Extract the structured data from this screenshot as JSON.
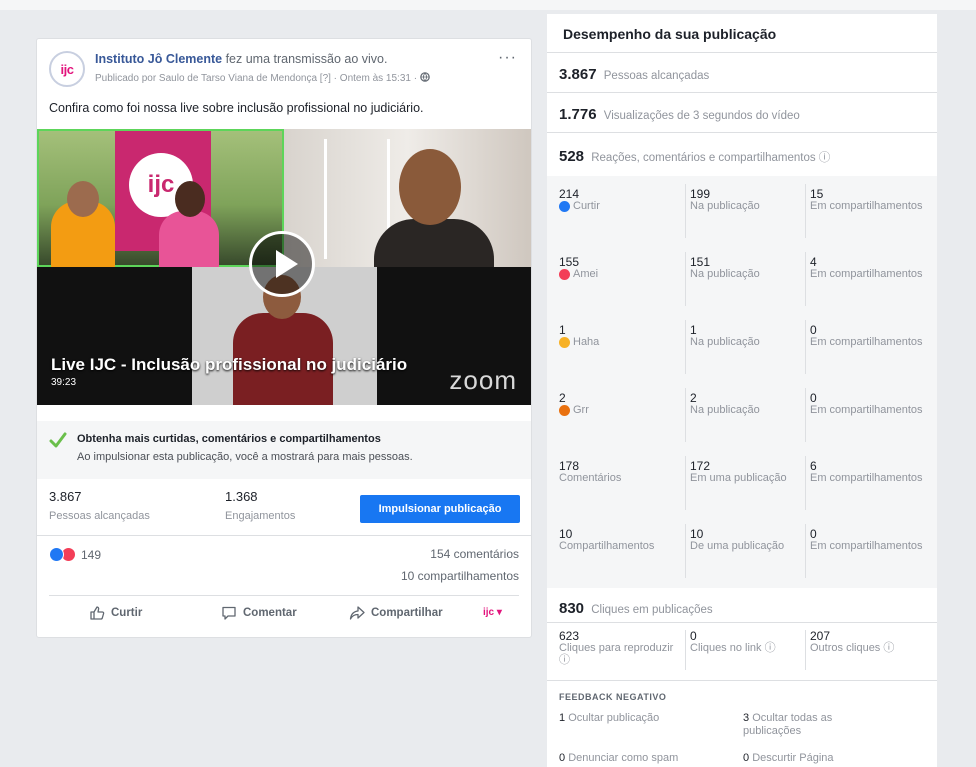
{
  "post": {
    "author": "Instituto Jô Clemente",
    "action_text": "fez uma transmissão ao vivo.",
    "published_by": "Publicado por Saulo de Tarso Viana de Mendonça [?] · Ontem às 15:31 ·",
    "avatar_text": "ijc",
    "more_label": "···",
    "caption": "Confira como foi nossa live sobre inclusão profissional no judiciário.",
    "video": {
      "title": "Live IJC - Inclusão profissional no judiciário",
      "duration": "39:23",
      "watermark": "zoom",
      "banner_text": "ijc"
    },
    "boost_tip": {
      "title": "Obtenha mais curtidas, comentários e compartilhamentos",
      "description": "Ao impulsionar esta publicação, você a mostrará para mais pessoas."
    },
    "stats": {
      "reached_num": "3.867",
      "reached_label": "Pessoas alcançadas",
      "engagement_num": "1.368",
      "engagement_label": "Engajamentos",
      "boost_button": "Impulsionar publicação"
    },
    "reactions_count": "149",
    "comments": "154 comentários",
    "shares": "10 compartilhamentos",
    "actions": {
      "like": "Curtir",
      "comment": "Comentar",
      "share": "Compartilhar"
    },
    "page_switch": "ijc ▾"
  },
  "panel": {
    "title": "Desempenho da sua publicação",
    "reached_num": "3.867",
    "reached_label": "Pessoas alcançadas",
    "views_num": "1.776",
    "views_label": "Visualizações de 3 segundos do vídeo",
    "reactions_num": "528",
    "reactions_label": "Reações, comentários e compartilhamentos ⓘ",
    "rows": [
      {
        "total": "214",
        "label": "Curtir",
        "icon": "like",
        "color": "#2078f4",
        "on_post": "199",
        "on_post_label": "Na publicação",
        "on_shares": "15",
        "on_shares_label": "Em compartilhamentos"
      },
      {
        "total": "155",
        "label": "Amei",
        "icon": "love",
        "color": "#f33e58",
        "on_post": "151",
        "on_post_label": "Na publicação",
        "on_shares": "4",
        "on_shares_label": "Em compartilhamentos"
      },
      {
        "total": "1",
        "label": "Haha",
        "icon": "haha",
        "color": "#f7b125",
        "on_post": "1",
        "on_post_label": "Na publicação",
        "on_shares": "0",
        "on_shares_label": "Em compartilhamentos"
      },
      {
        "total": "2",
        "label": "Grr",
        "icon": "angry",
        "color": "#e9710f",
        "on_post": "2",
        "on_post_label": "Na publicação",
        "on_shares": "0",
        "on_shares_label": "Em compartilhamentos"
      },
      {
        "total": "178",
        "label": "Comentários",
        "icon": "",
        "color": "",
        "on_post": "172",
        "on_post_label": "Em uma publicação",
        "on_shares": "6",
        "on_shares_label": "Em compartilhamentos"
      },
      {
        "total": "10",
        "label": "Compartilhamentos",
        "icon": "",
        "color": "",
        "on_post": "10",
        "on_post_label": "De uma publicação",
        "on_shares": "0",
        "on_shares_label": "Em compartilhamentos"
      }
    ],
    "clicks_num": "830",
    "clicks_label": "Cliques em publicações",
    "clicks": {
      "play_num": "623",
      "play_label": "Cliques para reproduzir ⓘ",
      "link_num": "0",
      "link_label": "Cliques no link ⓘ",
      "other_num": "207",
      "other_label": "Outros cliques ⓘ"
    },
    "negative": {
      "title": "FEEDBACK NEGATIVO",
      "hide_post_num": "1",
      "hide_post_label": "Ocultar publicação",
      "hide_all_num": "3",
      "hide_all_label": "Ocultar todas as publicações",
      "spam_num": "0",
      "spam_label": "Denunciar como spam",
      "unlike_num": "0",
      "unlike_label": "Descurtir Página"
    }
  }
}
